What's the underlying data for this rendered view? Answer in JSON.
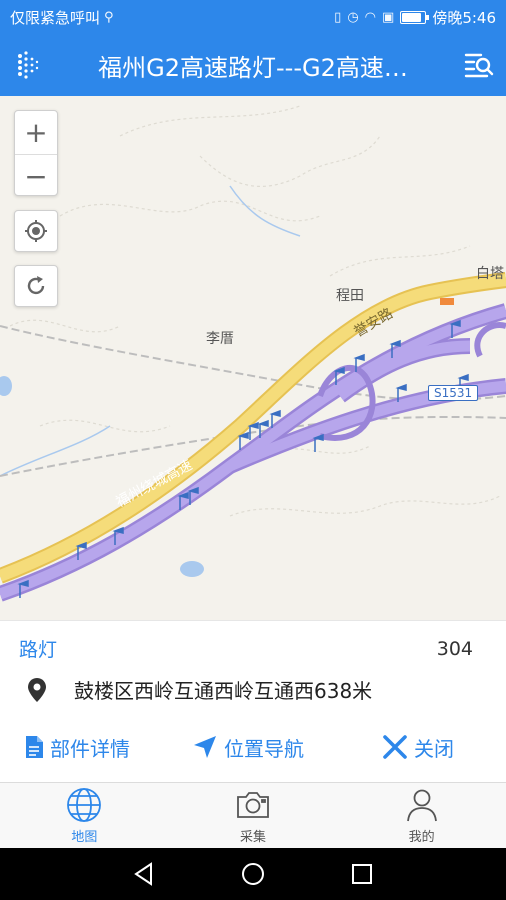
{
  "status_bar": {
    "carrier_text": "仅限紧急呼叫",
    "usb_icon": "usb-icon",
    "icons": [
      "vibrate-icon",
      "alarm-icon",
      "wifi-icon",
      "sim-alert-icon",
      "battery-icon"
    ],
    "time": "傍晚5:46",
    "battery_level": 0.9
  },
  "app_bar": {
    "title": "福州G2高速路灯---G2高速…",
    "menu_icon": "dots-menu-icon",
    "list_icon": "search-list-icon",
    "color": "#2d87ea"
  },
  "map": {
    "zoom_in": "+",
    "zoom_out": "−",
    "locate_icon": "locate-icon",
    "refresh_icon": "refresh-icon",
    "labels": {
      "place_chengtian": "程田",
      "place_lidun": "李厝",
      "place_baita": "白塔",
      "road_name": "福州绕城高速",
      "road_yuan": "誉安路",
      "shield": "S1531"
    },
    "colors": {
      "background": "#f4f2ec",
      "highway": "#f5dc7a",
      "selected_road": "#a591e0",
      "railway": "#b8b8b8"
    }
  },
  "info_panel": {
    "type_label": "路灯",
    "count": "304",
    "location_icon": "location-pin-icon",
    "address": "鼓楼区西岭互通西岭互通西638米",
    "actions": {
      "detail": "部件详情",
      "navigate": "位置导航",
      "close": "关闭"
    }
  },
  "tab_bar": {
    "tabs": [
      {
        "label": "地图",
        "icon": "globe-icon",
        "active": true
      },
      {
        "label": "采集",
        "icon": "camera-icon",
        "active": false
      },
      {
        "label": "我的",
        "icon": "user-icon",
        "active": false
      }
    ]
  },
  "nav_bar": {
    "buttons": [
      "back-icon",
      "home-icon",
      "recents-icon"
    ]
  }
}
